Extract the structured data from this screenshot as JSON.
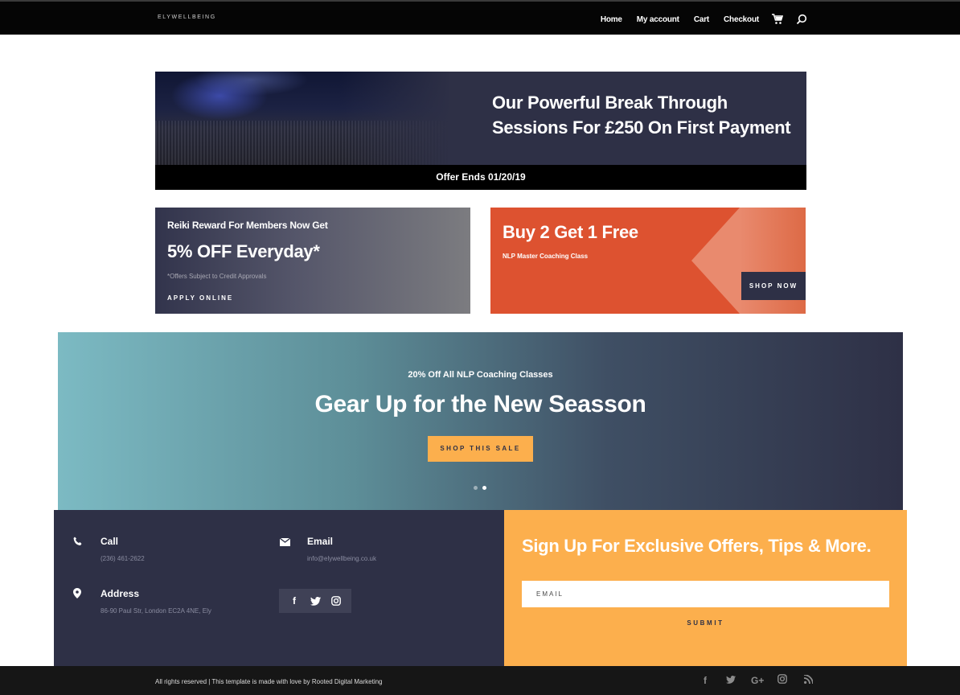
{
  "header": {
    "logo": "ELYWELLBEING",
    "nav": [
      "Home",
      "My account",
      "Cart",
      "Checkout"
    ],
    "icons": [
      "cart-icon",
      "search-icon"
    ]
  },
  "hero": {
    "title_line1": "Our Powerful Break Through",
    "title_line2": "Sessions For £250 On First Payment",
    "offer": "Offer Ends 01/20/19"
  },
  "promo_left": {
    "kicker": "Reiki Reward For Members Now Get",
    "headline": "5% OFF Everyday*",
    "fine_print": "*Offers Subject to Credit Approvals",
    "cta": "APPLY ONLINE"
  },
  "promo_right": {
    "headline": "Buy 2 Get 1 Free",
    "sub": "NLP Master Coaching Class",
    "cta": "SHOP NOW"
  },
  "slider": {
    "kicker": "20% Off All NLP Coaching Classes",
    "title": "Gear Up for the New Seasson",
    "button": "SHOP THIS SALE",
    "slide_count": 2,
    "active_slide": 2
  },
  "contact": {
    "call_title": "Call",
    "call_value": "(236) 461-2622",
    "email_title": "Email",
    "email_value": "info@elywellbeing.co.uk",
    "address_title": "Address",
    "address_value": "86-90 Paul Str, London EC2A 4NE, Ely",
    "social": [
      "f",
      "t",
      "ig"
    ]
  },
  "signup": {
    "title": "Sign Up For Exclusive Offers, Tips & More.",
    "email_placeholder": "EMAIL",
    "submit": "SUBMIT"
  },
  "footer": {
    "copyright": "All rights reserved | This template is made with love by Rooted Digital Marketing",
    "social_icons": [
      "f",
      "t",
      "G+",
      "ig",
      "rss"
    ]
  },
  "colors": {
    "navy": "#2e3046",
    "orange": "#dd5230",
    "amber": "#fcaf4d",
    "teal": "#7cbac3"
  }
}
